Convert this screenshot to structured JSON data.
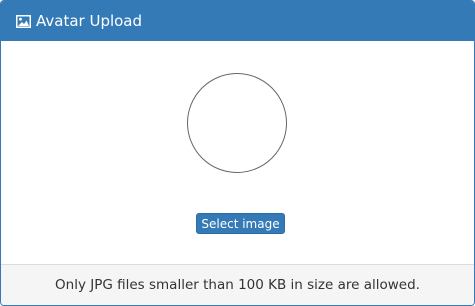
{
  "panel": {
    "title": "Avatar Upload",
    "title_icon": "image-icon",
    "accent_color": "#337ab7"
  },
  "avatar": {
    "shape": "circle",
    "image": "empty"
  },
  "actions": {
    "select_image_label": "Select image"
  },
  "footer": {
    "note": "Only JPG files smaller than 100 KB in size are allowed."
  }
}
